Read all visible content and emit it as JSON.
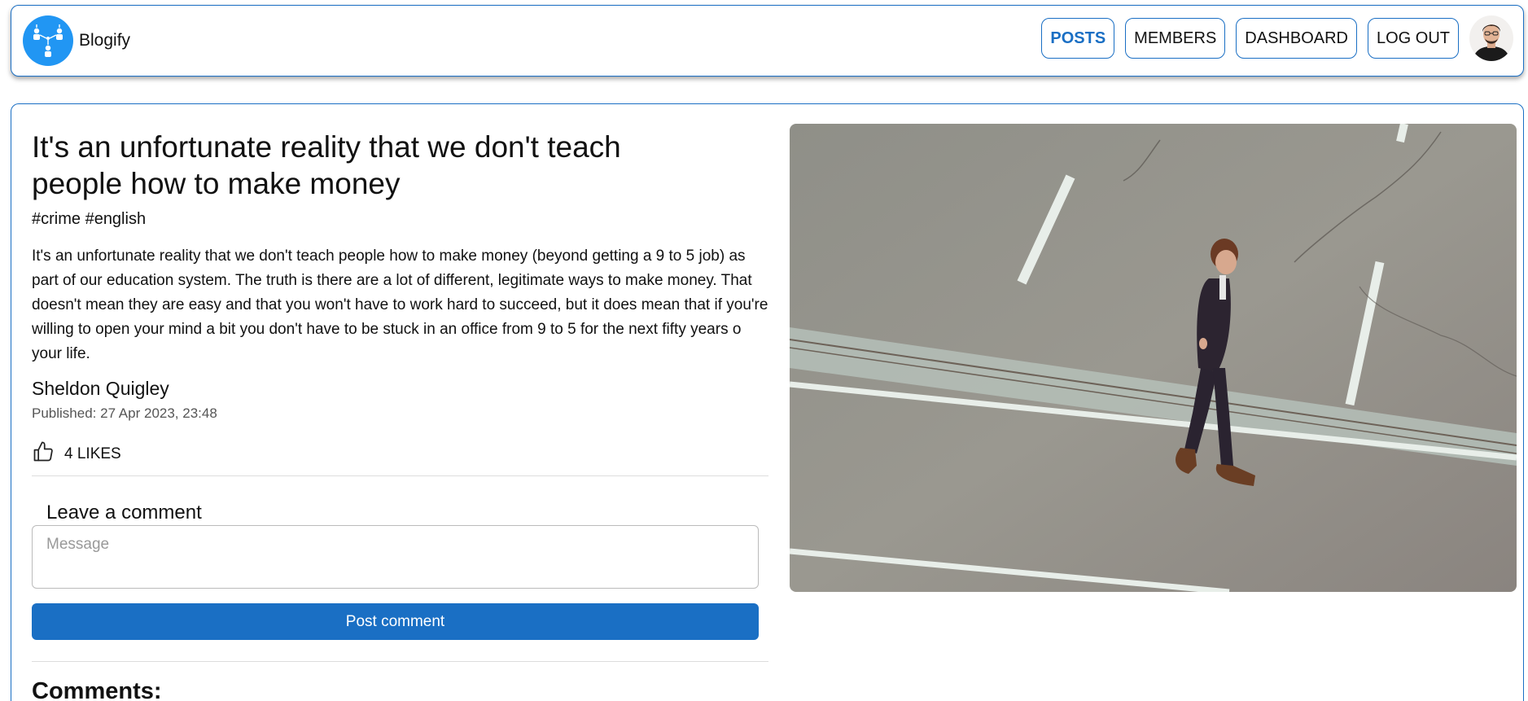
{
  "brand": {
    "name": "Blogify",
    "logo_icon": "network-people-icon",
    "logo_color": "#2196f3"
  },
  "nav": {
    "items": [
      {
        "label": "POSTS",
        "active": true
      },
      {
        "label": "MEMBERS",
        "active": false
      },
      {
        "label": "DASHBOARD",
        "active": false
      },
      {
        "label": "LOG OUT",
        "active": false
      }
    ],
    "avatar_icon": "user-avatar"
  },
  "post": {
    "title": "It's an unfortunate reality that we don't teach people how to make money",
    "tags": "#crime #english",
    "body": "It's an unfortunate reality that we don't teach people how to make money (beyond getting a 9 to 5 job) as part of our education system. The truth is there are a lot of different, legitimate ways to make money. That doesn't mean they are easy and that you won't have to work hard to succeed, but it does mean that if you're willing to open your mind a bit you don't have to be stuck in an office from 9 to 5 for the next fifty years o your life.",
    "author": "Sheldon Quigley",
    "published": "Published: 27 Apr 2023, 23:48",
    "likes": "4 LIKES",
    "like_icon": "thumbs-up-icon",
    "image_icon": "man-walking-on-road-photo"
  },
  "comment_form": {
    "heading": "Leave a comment",
    "placeholder": "Message",
    "value": "",
    "submit_label": "Post comment"
  },
  "comments": {
    "heading": "Comments:"
  },
  "colors": {
    "accent": "#1a6fc4",
    "border": "#1a6fc4"
  }
}
